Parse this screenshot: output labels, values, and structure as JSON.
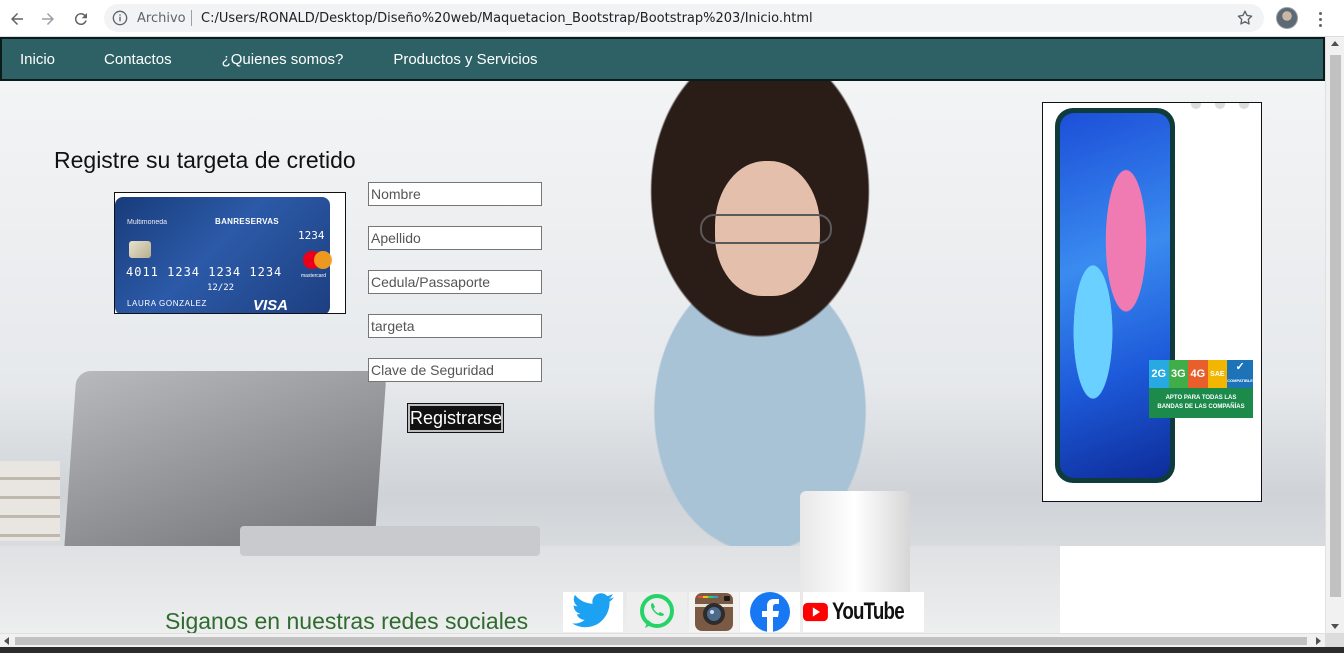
{
  "browser": {
    "scheme_label": "Archivo",
    "url": "C:/Users/RONALD/Desktop/Diseño%20web/Maquetacion_Bootstrap/Bootstrap%203/Inicio.html",
    "icons": [
      "back-arrow-icon",
      "forward-arrow-icon",
      "reload-icon",
      "info-icon",
      "star-icon",
      "kebab-menu-icon"
    ]
  },
  "navbar": {
    "bg_color": "#2d6166",
    "items": [
      {
        "label": "Inicio"
      },
      {
        "label": "Contactos"
      },
      {
        "label": "¿Quienes somos?"
      },
      {
        "label": "Productos y Servicios"
      }
    ]
  },
  "registration": {
    "title": "Registre su targeta de cretido",
    "card": {
      "label": "Multimoneda",
      "bank": "BANRESERVAS",
      "last4": "1234",
      "number": "4011 1234 1234 1234",
      "expiry": "12/22",
      "holder": "LAURA GONZALEZ",
      "network": "VISA",
      "mastercard_label": "mastercard"
    },
    "fields": [
      {
        "placeholder": "Nombre",
        "value": ""
      },
      {
        "placeholder": "Apellido",
        "value": ""
      },
      {
        "placeholder": "Cedula/Passaporte",
        "value": ""
      },
      {
        "placeholder": "targeta",
        "value": ""
      },
      {
        "placeholder": "Clave de Seguridad",
        "value": ""
      }
    ],
    "submit_label": "Registrarse"
  },
  "ad": {
    "badge": {
      "tags": [
        "2G",
        "3G",
        "4G",
        "SAE",
        "COMPATIBLE"
      ],
      "line1": "APTO PARA TODAS LAS",
      "line2": "BANDAS DE LAS COMPAÑÍAS"
    }
  },
  "social": {
    "text": "Siganos en nuestras redes sociales",
    "youtube_label": "YouTube",
    "icons": [
      "twitter-icon",
      "whatsapp-icon",
      "instagram-icon",
      "facebook-icon",
      "youtube-icon"
    ]
  }
}
